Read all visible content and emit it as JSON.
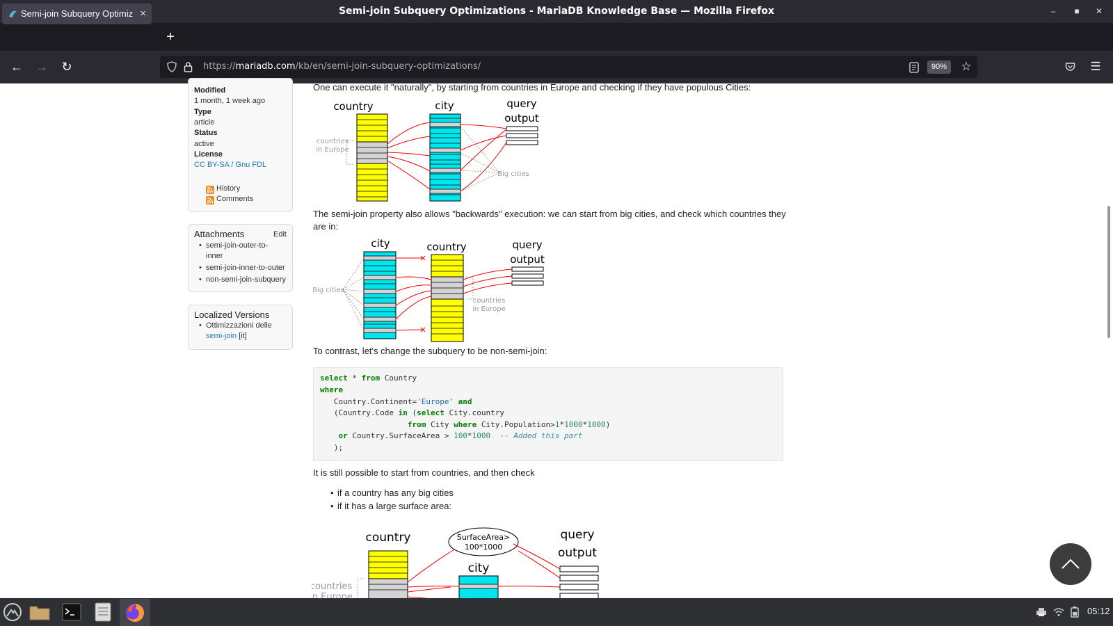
{
  "window": {
    "title": "Semi-join Subquery Optimizations - MariaDB Knowledge Base — Mozilla Firefox"
  },
  "tab": {
    "label": "Semi-join Subquery Optimiz",
    "close": "×"
  },
  "url": {
    "prefix": "https://",
    "domain": "mariadb.com",
    "path": "/kb/en/semi-join-subquery-optimizations/"
  },
  "zoom": "90%",
  "sidebar": {
    "meta": [
      {
        "label": "Modified",
        "value": "1 month, 1 week ago"
      },
      {
        "label": "Type",
        "value": "article"
      },
      {
        "label": "Status",
        "value": "active"
      },
      {
        "label": "License",
        "value": "CC BY-SA / Gnu FDL"
      }
    ],
    "feeds": [
      "History",
      "Comments"
    ],
    "attachments": {
      "title": "Attachments",
      "edit": "Edit",
      "items": [
        "semi-join-outer-to-",
        "inner",
        "semi-join-inner-to-outer",
        "non-semi-join-subquery"
      ]
    },
    "localized": {
      "title": "Localized Versions",
      "link_line1": "Ottimizzazioni delle",
      "link_line2": "semi-join",
      "lang": "[it]"
    }
  },
  "article": {
    "p1": "One can execute it \"naturally\", by starting from countries in Europe and checking if they have populous Cities:",
    "p2a": "The semi-join property also allows \"backwards\" execution: we can start from big cities, and check which countries they",
    "p2b": "are in:",
    "p3": "To contrast, let's change the subquery to be non-semi-join:",
    "p4": "It is still possible to start from countries, and then check",
    "list": [
      "if a country has any big cities",
      "if it has a large surface area:"
    ]
  },
  "diagram1": {
    "col1": "country",
    "col2": "city",
    "out1": "query",
    "out2": "output",
    "left1": "countries",
    "left2": "in Europe",
    "right": "Big cities"
  },
  "diagram2": {
    "col1": "city",
    "col2": "country",
    "out1": "query",
    "out2": "output",
    "left": "Big cities",
    "right1": "countries",
    "right2": "in Europe"
  },
  "diagram3": {
    "col1": "country",
    "ellipse1": "SurfaceArea>",
    "ellipse2": "100*1000",
    "col2": "city",
    "out1": "query",
    "out2": "output",
    "left1": "countries",
    "left2": "in Europe"
  },
  "code": {
    "l1a": "select",
    "l1b": " * ",
    "l1c": "from",
    "l1d": " Country",
    "l2": "where",
    "l3a": "   Country.Continent=",
    "l3b": "'Europe'",
    "l3c": " and",
    "l4a": "   (Country.Code ",
    "l4b": "in",
    "l4c": " (",
    "l4d": "select",
    "l4e": " City.country",
    "l5a": "                   ",
    "l5b": "from",
    "l5c": " City ",
    "l5d": "where",
    "l5e": " City.Population>",
    "l5f": "1",
    "l5g": "*",
    "l5h": "1000",
    "l5i": "*",
    "l5j": "1000",
    "l5k": ")",
    "l6a": "    ",
    "l6b": "or",
    "l6c": " Country.SurfaceArea > ",
    "l6d": "100",
    "l6e": "*",
    "l6f": "1000",
    "l6g": "  -- Added this part",
    "l7": "   );"
  },
  "taskbar": {
    "clock": "05:12"
  }
}
